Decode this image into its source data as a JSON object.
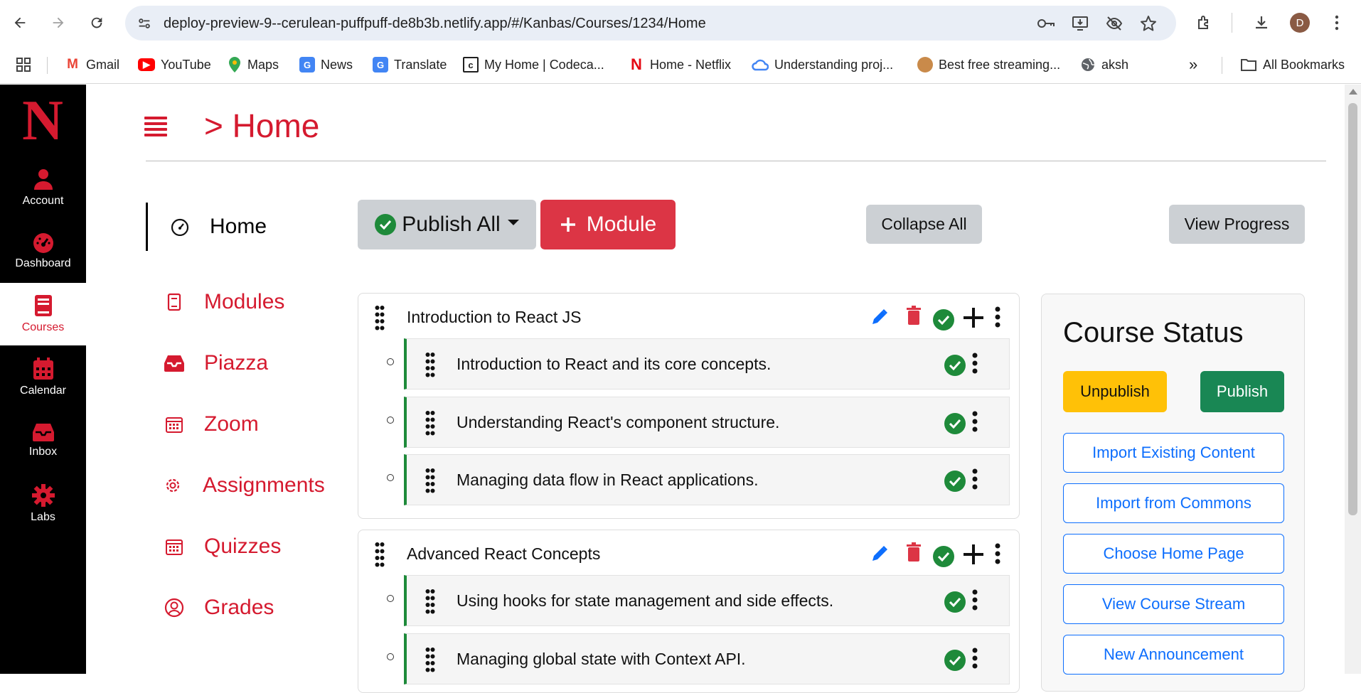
{
  "browser": {
    "url": "deploy-preview-9--cerulean-puffpuff-de8b3b.netlify.app/#/Kanbas/Courses/1234/Home",
    "profile_initial": "D",
    "bookmarks": [
      {
        "label": "Gmail",
        "icon": "gmail-icon",
        "color": "#ea4335"
      },
      {
        "label": "YouTube",
        "icon": "youtube-icon",
        "color": "#ff0000"
      },
      {
        "label": "Maps",
        "icon": "maps-icon",
        "color": "#34a853"
      },
      {
        "label": "News",
        "icon": "news-icon",
        "color": "#4285f4"
      },
      {
        "label": "Translate",
        "icon": "translate-icon",
        "color": "#4285f4"
      },
      {
        "label": "My Home | Codeca...",
        "icon": "codecademy-icon",
        "color": "#1f1f1f"
      },
      {
        "label": "Home - Netflix",
        "icon": "netflix-icon",
        "color": "#e50914"
      },
      {
        "label": "Understanding proj...",
        "icon": "cloud-icon",
        "color": "#4285f4"
      },
      {
        "label": "Best free streaming...",
        "icon": "avatar-icon",
        "color": "#c98a4a"
      },
      {
        "label": "aksh",
        "icon": "globe-icon",
        "color": "#5f6368"
      }
    ],
    "all_bookmarks": "All Bookmarks"
  },
  "kanbas_nav": {
    "logo": "N",
    "items": [
      {
        "label": "Account",
        "icon": "user-icon"
      },
      {
        "label": "Dashboard",
        "icon": "speedometer-icon"
      },
      {
        "label": "Courses",
        "icon": "book-icon"
      },
      {
        "label": "Calendar",
        "icon": "calendar-icon"
      },
      {
        "label": "Inbox",
        "icon": "inbox-icon"
      },
      {
        "label": "Labs",
        "icon": "gear-icon"
      }
    ]
  },
  "header": {
    "breadcrumb": "> Home"
  },
  "course_nav": [
    {
      "label": "Home"
    },
    {
      "label": "Modules"
    },
    {
      "label": "Piazza"
    },
    {
      "label": "Zoom"
    },
    {
      "label": "Assignments"
    },
    {
      "label": "Quizzes"
    },
    {
      "label": "Grades"
    }
  ],
  "toolbar": {
    "publish_all": "Publish All",
    "module": "Module",
    "collapse_all": "Collapse All",
    "view_progress": "View Progress"
  },
  "modules": [
    {
      "title": "Introduction to React JS",
      "lessons": [
        "Introduction to React and its core concepts.",
        "Understanding React's component structure.",
        "Managing data flow in React applications."
      ]
    },
    {
      "title": "Advanced React Concepts",
      "lessons": [
        "Using hooks for state management and side effects.",
        "Managing global state with Context API."
      ]
    }
  ],
  "course_status": {
    "title": "Course Status",
    "unpublish": "Unpublish",
    "publish": "Publish",
    "actions": [
      "Import Existing Content",
      "Import from Commons",
      "Choose Home Page",
      "View Course Stream",
      "New Announcement"
    ]
  },
  "colors": {
    "kanbas_red": "#d51a2f",
    "success": "#1e8a3a",
    "warning": "#ffc107",
    "primary": "#0d6efd",
    "secondary": "#ccd0d4"
  }
}
